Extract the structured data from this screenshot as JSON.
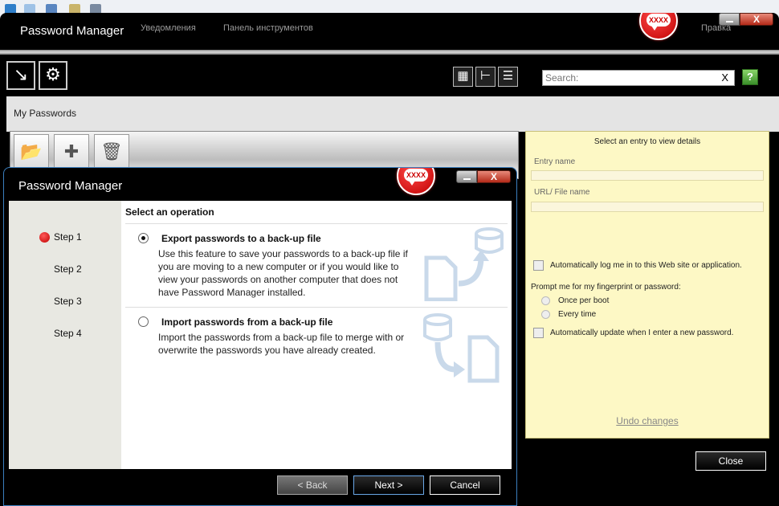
{
  "background_menu": {
    "notifications": "Уведомления",
    "toolbar": "Панель инструментов",
    "help": "Правка"
  },
  "main_window": {
    "title": "Password Manager",
    "badge": "XXXX",
    "close_glyph": "X",
    "search": {
      "placeholder": "Search:",
      "clear": "X"
    },
    "breadcrumb": "My Passwords",
    "close_button": "Close"
  },
  "details": {
    "header": "Select an entry to view details",
    "entry_name_label": "Entry name",
    "url_label": "URL/ File name",
    "auto_login": "Automatically log me in to this Web site or application.",
    "prompt_label": "Prompt me for my fingerprint or password:",
    "once_per_boot": "Once per boot",
    "every_time": "Every time",
    "auto_update": "Automatically update when I enter a new password.",
    "undo": "Undo changes"
  },
  "dialog": {
    "title": "Password Manager",
    "badge": "XXXX",
    "close_glyph": "X",
    "steps": [
      "Step 1",
      "Step 2",
      "Step 3",
      "Step 4"
    ],
    "current_step": 1,
    "select_operation": "Select an operation",
    "export": {
      "title": "Export passwords to a back-up file",
      "description": "Use this feature to save your passwords to a back-up file if you are moving to a new computer or if you would like to view your passwords on another computer that does not have Password Manager installed.",
      "selected": true
    },
    "import": {
      "title": "Import passwords from a back-up file",
      "description": "Import the passwords from a back-up file to merge with or overwrite the passwords you have already created.",
      "selected": false
    },
    "buttons": {
      "back": "< Back",
      "next": "Next >",
      "cancel": "Cancel"
    }
  },
  "colors": {
    "accent_red": "#c00000",
    "details_bg": "#fdf8c5",
    "dialog_border": "#3b7fbf"
  }
}
